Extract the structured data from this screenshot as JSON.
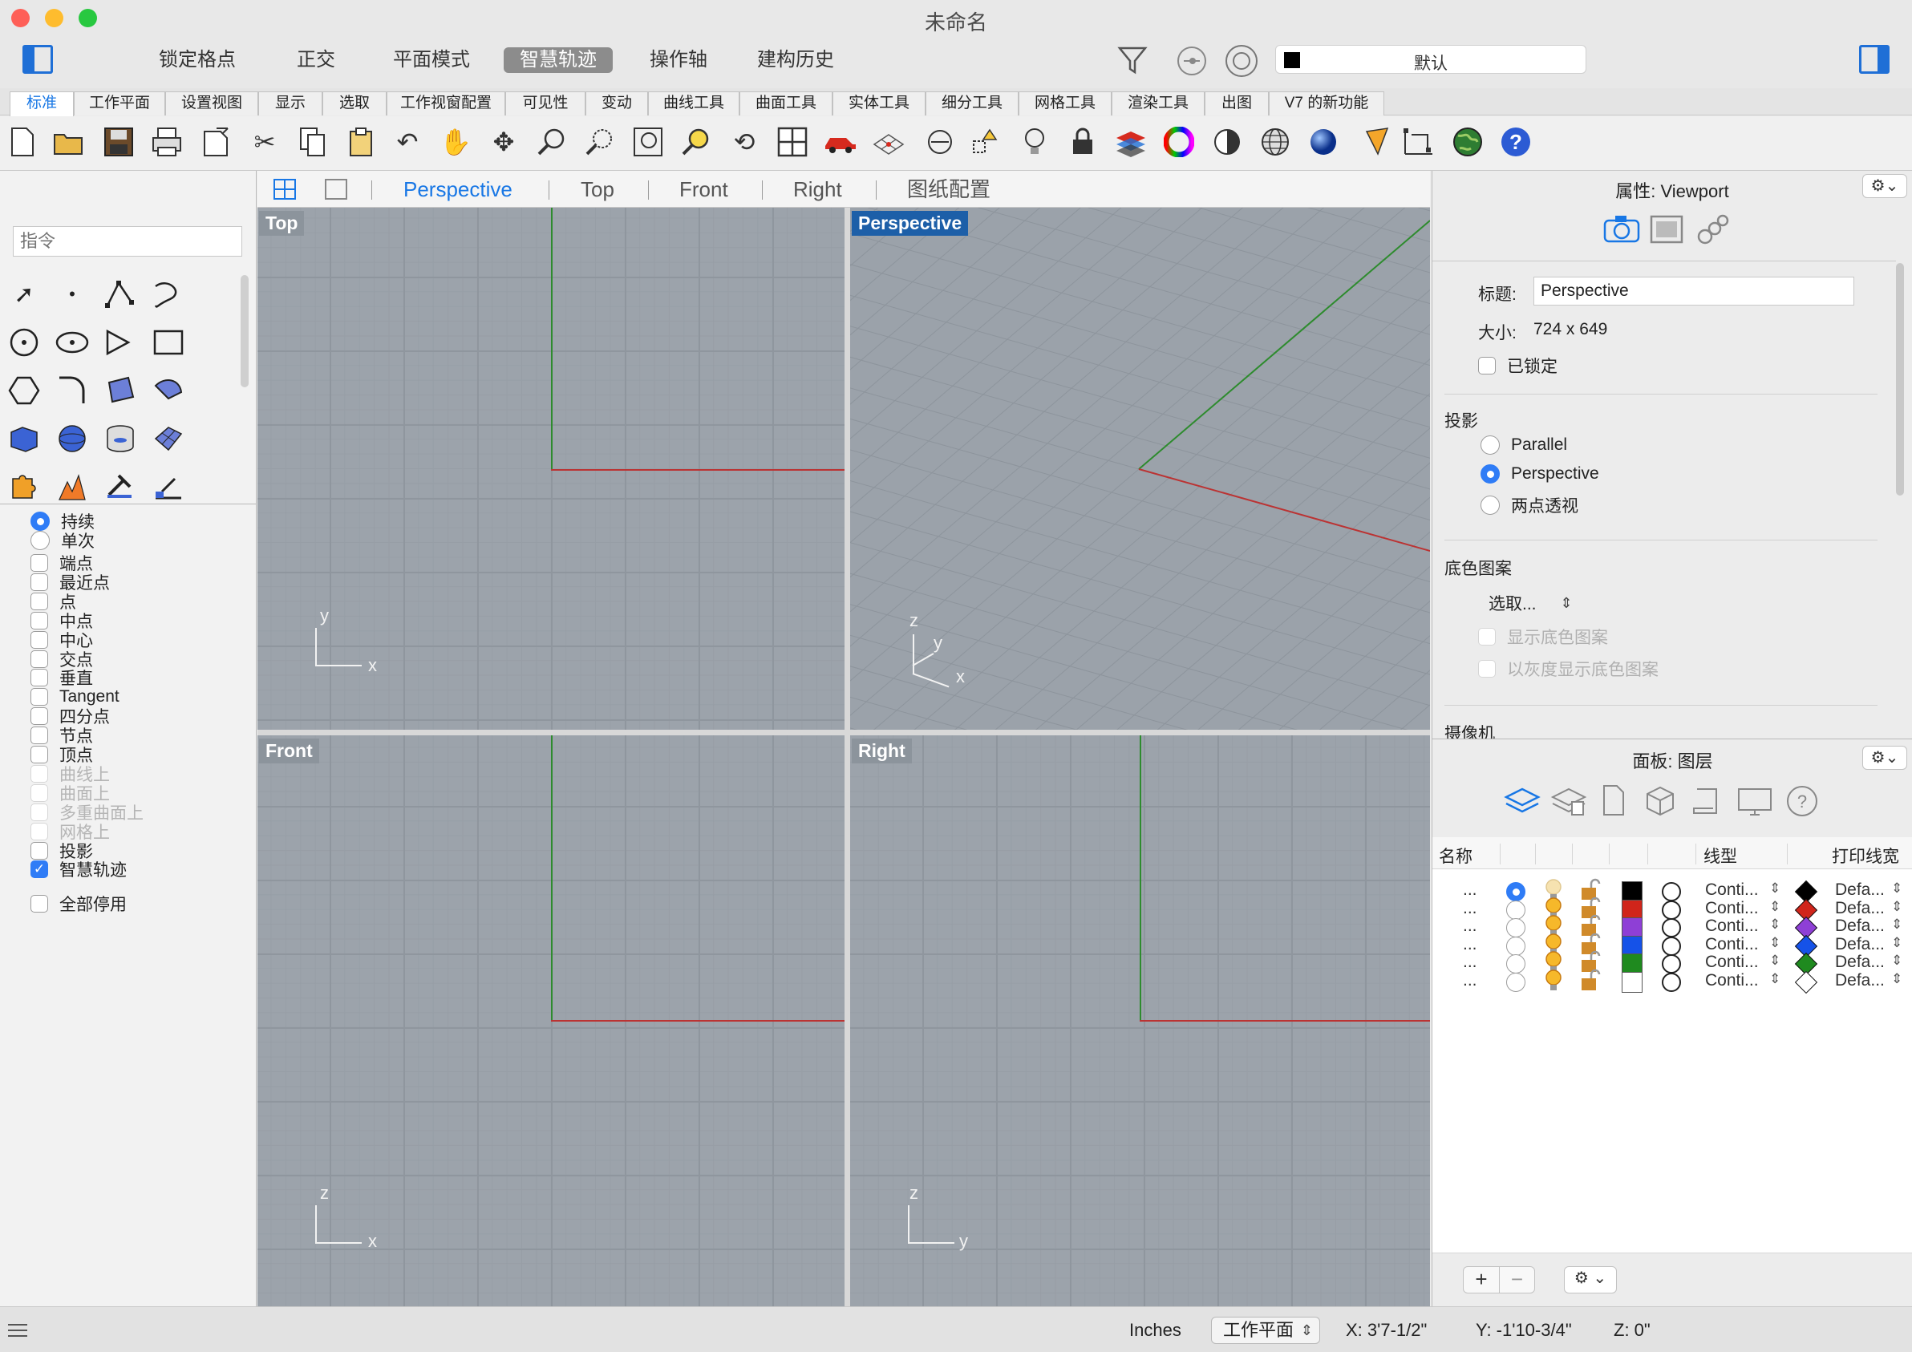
{
  "window": {
    "title": "未命名"
  },
  "toolbar": {
    "modes": [
      "锁定格点",
      "正交",
      "平面模式",
      "智慧轨迹",
      "操作轴",
      "建构历史"
    ],
    "active_mode": "智慧轨迹",
    "layer_label": "默认",
    "layer_swatch_color": "#000000"
  },
  "tabs": [
    "标准",
    "工作平面",
    "设置视图",
    "显示",
    "选取",
    "工作视窗配置",
    "可见性",
    "变动",
    "曲线工具",
    "曲面工具",
    "实体工具",
    "细分工具",
    "网格工具",
    "渲染工具",
    "出图",
    "V7 的新功能"
  ],
  "active_tab": "标准",
  "icons": [
    "new-file-icon",
    "open-icon",
    "save-icon",
    "print-icon",
    "export-icon",
    "cut-icon",
    "copy-icon",
    "paste-icon",
    "undo-icon",
    "pan-hand-icon",
    "rotate-view-icon",
    "zoom-icon",
    "zoom-window-icon",
    "zoom-extents-icon",
    "zoom-selected-icon",
    "rotate-camera-icon",
    "four-views-icon",
    "car-icon",
    "grid-plane-icon",
    "cplane-origin-icon",
    "snap-points-icon",
    "light-bulb-icon",
    "lock-icon",
    "layer-color-icon",
    "color-wheel-icon",
    "shade-sphere-icon",
    "wireframe-sphere-icon",
    "render-sphere-icon",
    "pencil-annotate-icon",
    "dimension-icon",
    "globe-icon",
    "help-icon"
  ],
  "left_panel": {
    "command_placeholder": "指令",
    "tools": [
      "select-arrow-icon",
      "point-icon",
      "polyline-icon",
      "curve-icon",
      "circle-icon",
      "ellipse-icon",
      "arc-icon",
      "rectangle-icon",
      "polygon-icon",
      "fillet-icon",
      "surface-icon",
      "patch-icon",
      "box-icon",
      "sphere-icon",
      "cylinder-icon",
      "mesh-icon",
      "puzzle-icon",
      "explode-icon",
      "hammer-icon",
      "dimension-tool-icon"
    ],
    "osnap_radios": [
      {
        "label": "持续",
        "on": true
      },
      {
        "label": "单次",
        "on": false
      }
    ],
    "osnap_checks": [
      {
        "label": "端点",
        "checked": false,
        "disabled": false
      },
      {
        "label": "最近点",
        "checked": false,
        "disabled": false
      },
      {
        "label": "点",
        "checked": false,
        "disabled": false
      },
      {
        "label": "中点",
        "checked": false,
        "disabled": false
      },
      {
        "label": "中心",
        "checked": false,
        "disabled": false
      },
      {
        "label": "交点",
        "checked": false,
        "disabled": false
      },
      {
        "label": "垂直",
        "checked": false,
        "disabled": false
      },
      {
        "label": "Tangent",
        "checked": false,
        "disabled": false
      },
      {
        "label": "四分点",
        "checked": false,
        "disabled": false
      },
      {
        "label": "节点",
        "checked": false,
        "disabled": false
      },
      {
        "label": "顶点",
        "checked": false,
        "disabled": false
      },
      {
        "label": "曲线上",
        "checked": false,
        "disabled": true
      },
      {
        "label": "曲面上",
        "checked": false,
        "disabled": true
      },
      {
        "label": "多重曲面上",
        "checked": false,
        "disabled": true
      },
      {
        "label": "网格上",
        "checked": false,
        "disabled": true
      },
      {
        "label": "投影",
        "checked": false,
        "disabled": false
      },
      {
        "label": "智慧轨迹",
        "checked": true,
        "disabled": false
      }
    ],
    "disable_all": "全部停用"
  },
  "viewport_tabs": {
    "items": [
      "Perspective",
      "Top",
      "Front",
      "Right",
      "图纸配置"
    ],
    "active": "Perspective"
  },
  "viewports": {
    "top": {
      "label": "Top",
      "axes": [
        "y",
        "x"
      ]
    },
    "perspective": {
      "label": "Perspective",
      "axes": [
        "z",
        "y",
        "x"
      ]
    },
    "front": {
      "label": "Front",
      "axes": [
        "z",
        "x"
      ]
    },
    "right": {
      "label": "Right",
      "axes": [
        "z",
        "y"
      ]
    }
  },
  "properties": {
    "title": "属性: Viewport",
    "title_label": "标题:",
    "title_value": "Perspective",
    "size_label": "大小:",
    "size_value": "724 x 649",
    "locked_label": "已锁定",
    "projection_label": "投影",
    "projections": [
      {
        "label": "Parallel",
        "on": false
      },
      {
        "label": "Perspective",
        "on": true
      },
      {
        "label": "两点透视",
        "on": false
      }
    ],
    "background_label": "底色图案",
    "background_select": "选取...",
    "show_background": "显示底色图案",
    "grayscale_background": "以灰度显示底色图案",
    "camera_label": "摄像机"
  },
  "layers": {
    "title": "面板: 图层",
    "col_name": "名称",
    "col_linetype": "线型",
    "col_printwidth": "打印线宽",
    "rows": [
      {
        "name": "...",
        "current": true,
        "color": "#000000",
        "linetype": "Conti...",
        "printwidth": "Defa...",
        "light_on": false
      },
      {
        "name": "...",
        "current": false,
        "color": "#d0251b",
        "linetype": "Conti...",
        "printwidth": "Defa...",
        "light_on": true
      },
      {
        "name": "...",
        "current": false,
        "color": "#8e3fd6",
        "linetype": "Conti...",
        "printwidth": "Defa...",
        "light_on": true
      },
      {
        "name": "...",
        "current": false,
        "color": "#1552e8",
        "linetype": "Conti...",
        "printwidth": "Defa...",
        "light_on": true
      },
      {
        "name": "...",
        "current": false,
        "color": "#1f8a1f",
        "linetype": "Conti...",
        "printwidth": "Defa...",
        "light_on": true
      },
      {
        "name": "...",
        "current": false,
        "color": "#ffffff",
        "linetype": "Conti...",
        "printwidth": "Defa...",
        "light_on": true
      }
    ]
  },
  "status": {
    "units": "Inches",
    "cplane": "工作平面",
    "x": "X: 3'7-1/2\"",
    "y": "Y: -1'10-3/4\"",
    "z": "Z: 0\""
  }
}
